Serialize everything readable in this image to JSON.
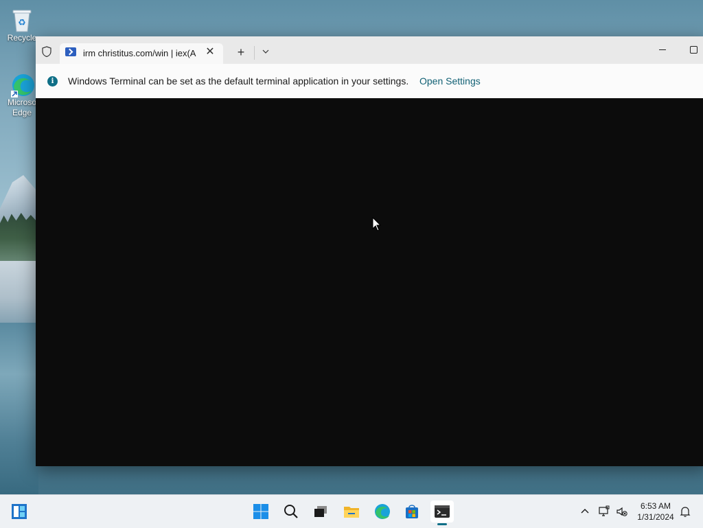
{
  "desktop": {
    "icons": [
      {
        "label": "Recycle",
        "icon": "recycle-bin-icon"
      },
      {
        "label_line1": "Microso",
        "label_line2": "Edge",
        "icon": "edge-icon"
      }
    ]
  },
  "window": {
    "tab_title": "irm christitus.com/win | iex(Ac",
    "new_tab_label": "+",
    "info_text": "Windows Terminal can be set as the default terminal application in your settings.",
    "info_link": "Open Settings"
  },
  "taskbar": {
    "items": [
      "widgets-icon",
      "start-icon",
      "search-icon",
      "task-view-icon",
      "file-explorer-icon",
      "edge-icon",
      "store-icon",
      "terminal-icon"
    ],
    "tray": [
      "chevron-up-icon",
      "network-icon",
      "volume-muted-icon"
    ],
    "time": "6:53 AM",
    "date": "1/31/2024"
  },
  "colors": {
    "accent": "#0f6f87",
    "console_bg": "#0c0c0c",
    "titlebar_bg": "#e9e9e9"
  }
}
